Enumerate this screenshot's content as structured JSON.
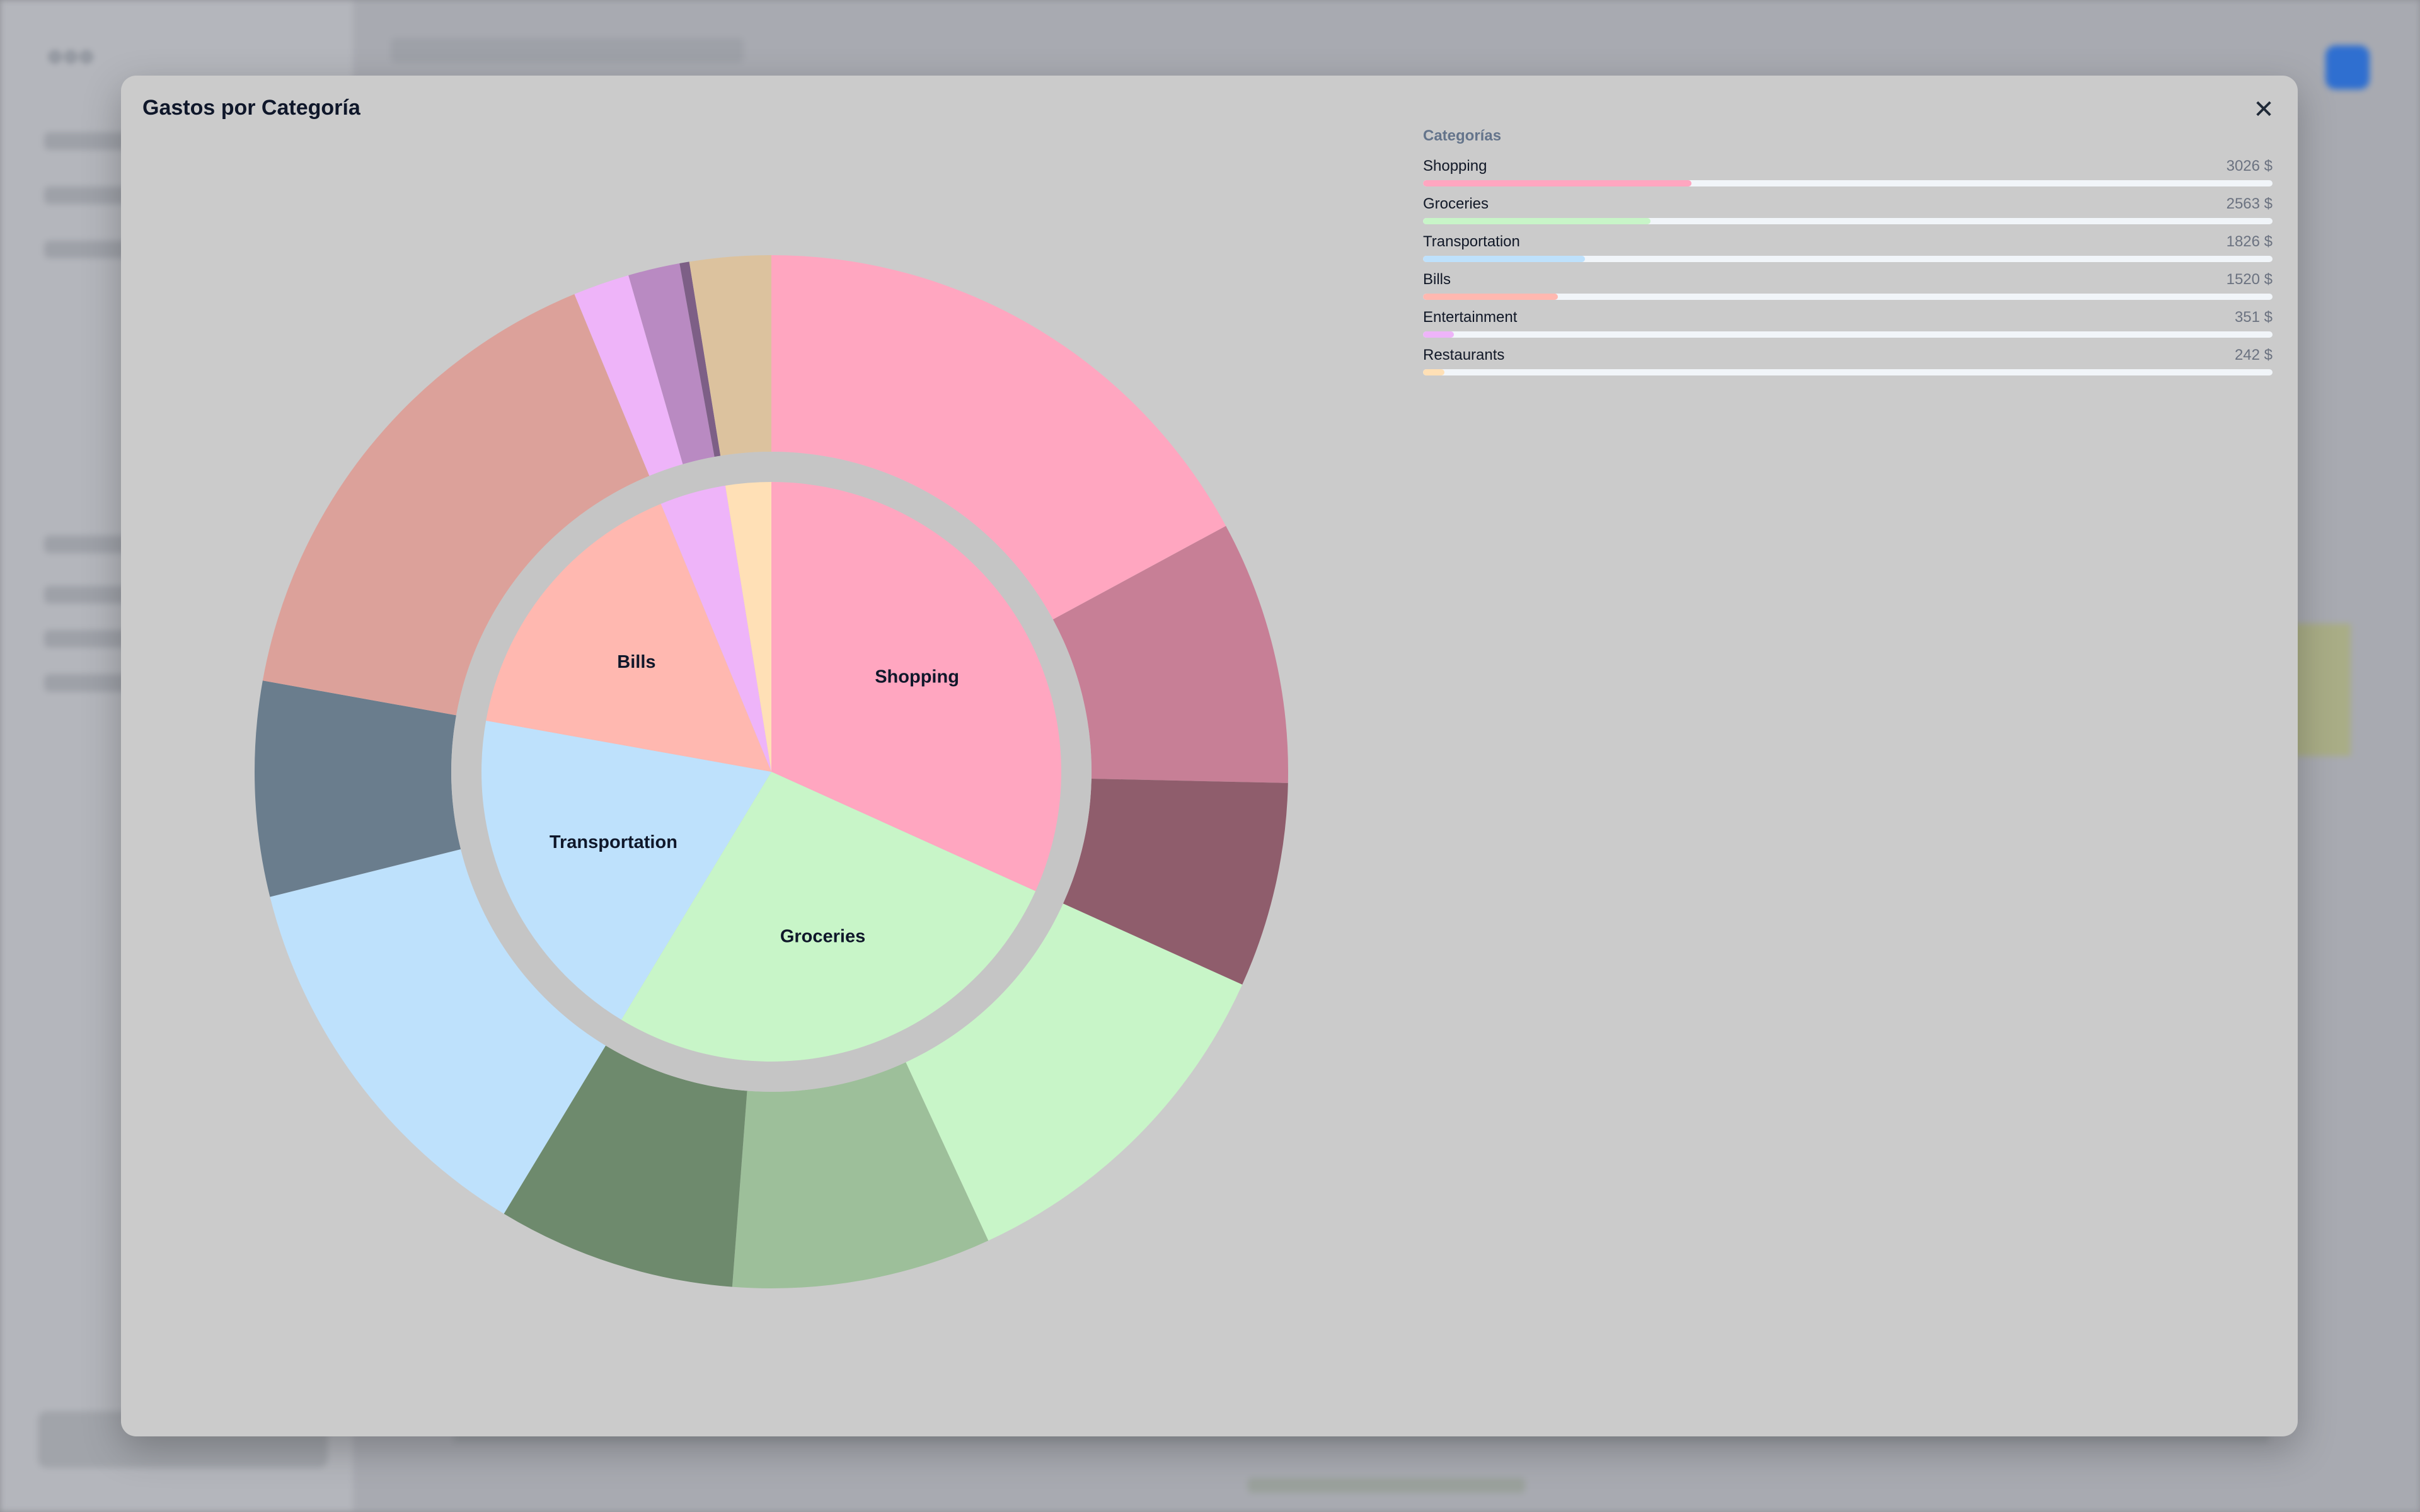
{
  "modal": {
    "title": "Gastos por Categoría",
    "close_icon": "close-icon"
  },
  "legend": {
    "heading": "Categorías",
    "items": [
      {
        "name": "Shopping",
        "value_label": "3026 $",
        "value": 3026,
        "color": "#ffa6c0"
      },
      {
        "name": "Groceries",
        "value_label": "2563 $",
        "value": 2563,
        "color": "#c8f5c8"
      },
      {
        "name": "Transportation",
        "value_label": "1826 $",
        "value": 1826,
        "color": "#bee1fc"
      },
      {
        "name": "Bills",
        "value_label": "1520 $",
        "value": 1520,
        "color": "#ffb8b0"
      },
      {
        "name": "Entertainment",
        "value_label": "351 $",
        "value": 351,
        "color": "#eeb4f9"
      },
      {
        "name": "Restaurants",
        "value_label": "242 $",
        "value": 242,
        "color": "#ffe0b6"
      }
    ]
  },
  "chart_data": {
    "type": "pie",
    "subtype": "sunburst",
    "title": "Gastos por Categoría",
    "inner": [
      {
        "name": "Shopping",
        "value": 3026,
        "color": "#ffa6c0",
        "label": "Shopping"
      },
      {
        "name": "Groceries",
        "value": 2563,
        "color": "#c8f5c8",
        "label": "Groceries"
      },
      {
        "name": "Transportation",
        "value": 1826,
        "color": "#bee1fc",
        "label": "Transportation"
      },
      {
        "name": "Bills",
        "value": 1520,
        "color": "#ffb8b0",
        "label": "Bills"
      },
      {
        "name": "Entertainment",
        "value": 351,
        "color": "#eeb4f9",
        "label": ""
      },
      {
        "name": "Restaurants",
        "value": 242,
        "color": "#ffe0b6",
        "label": ""
      }
    ],
    "outer": [
      {
        "parent": "Shopping",
        "value": 1630,
        "color": "#ffa6c0"
      },
      {
        "parent": "Shopping",
        "value": 785,
        "color": "#c77f96"
      },
      {
        "parent": "Shopping",
        "value": 611,
        "color": "#8f5d6c"
      },
      {
        "parent": "Groceries",
        "value": 1081,
        "color": "#c8f5c8"
      },
      {
        "parent": "Groceries",
        "value": 772,
        "color": "#9dbf9a"
      },
      {
        "parent": "Groceries",
        "value": 710,
        "color": "#6e8a6d"
      },
      {
        "parent": "Transportation",
        "value": 1186,
        "color": "#bee1fc"
      },
      {
        "parent": "Transportation",
        "value": 640,
        "color": "#6a7d8d"
      },
      {
        "parent": "Bills",
        "value": 1520,
        "color": "#dca19a"
      },
      {
        "parent": "Entertainment",
        "value": 168,
        "color": "#eeb4f9"
      },
      {
        "parent": "Entertainment",
        "value": 154,
        "color": "#b98ac2"
      },
      {
        "parent": "Entertainment",
        "value": 29,
        "color": "#7d5f86"
      },
      {
        "parent": "Restaurants",
        "value": 242,
        "color": "#dcc29e"
      }
    ]
  }
}
